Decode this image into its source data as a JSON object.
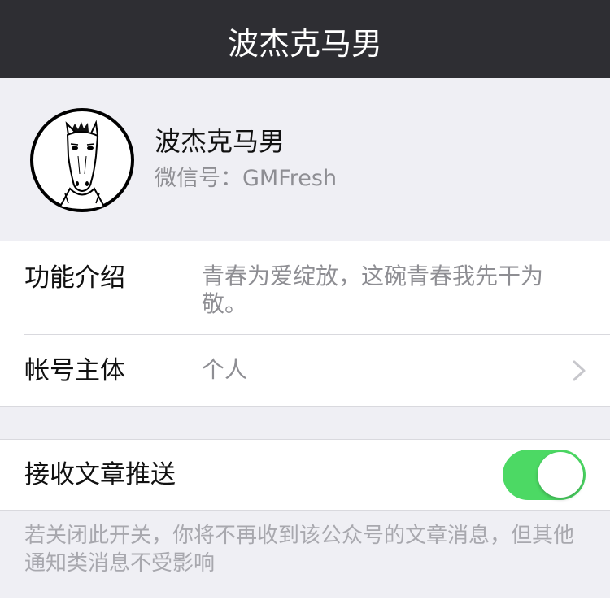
{
  "navbar": {
    "title": "波杰克马男"
  },
  "profile": {
    "avatar": "horse-avatar",
    "name": "波杰克马男",
    "wechat_id": "微信号：GMFresh"
  },
  "info": {
    "intro_label": "功能介绍",
    "intro_value": "青春为爱绽放，这碗青春我先干为敬。",
    "owner_label": "帐号主体",
    "owner_value": "个人"
  },
  "settings": {
    "push_label": "接收文章推送",
    "push_enabled": true,
    "toggle_color": "#4cd964",
    "footnote": "若关闭此开关，你将不再收到该公众号的文章消息，但其他通知类消息不受影响"
  }
}
